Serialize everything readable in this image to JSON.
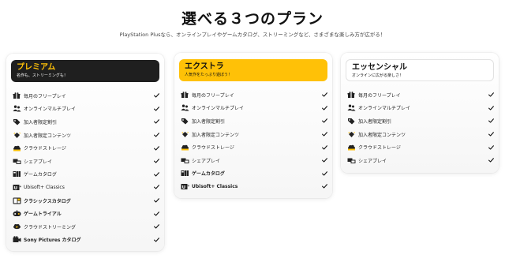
{
  "header": {
    "title": "選べる３つのプラン",
    "subtitle": "PlayStation Plusなら、オンラインプレイやゲームカタログ、ストリーミングなど、さまざまな楽しみ方が広がる！"
  },
  "colors": {
    "accent_yellow": "#ffc107",
    "dark": "#1f1f1f",
    "check": "#111111"
  },
  "plans": [
    {
      "name": "プレミアム",
      "description": "名作も、ストリーミングも！",
      "features": [
        {
          "label": "毎月のフリープレイ",
          "icon": "gift-icon",
          "bold": false
        },
        {
          "label": "オンラインマルチプレイ",
          "icon": "multiplayer-icon",
          "bold": false
        },
        {
          "label": "加入者限定割引",
          "icon": "discount-tag-icon",
          "bold": false
        },
        {
          "label": "加入者限定コンテンツ",
          "icon": "exclusive-content-icon",
          "bold": false
        },
        {
          "label": "クラウドストレージ",
          "icon": "cloud-storage-icon",
          "bold": false
        },
        {
          "label": "シェアプレイ",
          "icon": "share-play-icon",
          "bold": false
        },
        {
          "label": "ゲームカタログ",
          "icon": "game-catalog-icon",
          "bold": false
        },
        {
          "label": "Ubisoft+ Classics",
          "icon": "ubisoft-icon",
          "bold": false
        },
        {
          "label": "クラシックスカタログ",
          "icon": "classics-catalog-icon",
          "bold": true
        },
        {
          "label": "ゲームトライアル",
          "icon": "game-trial-icon",
          "bold": true
        },
        {
          "label": "クラウドストリーミング",
          "icon": "cloud-streaming-icon",
          "bold": false
        },
        {
          "label": "Sony Pictures カタログ",
          "icon": "sony-pictures-icon",
          "bold": true
        }
      ]
    },
    {
      "name": "エクストラ",
      "description": "人気作をたっぷり遊ぼう！",
      "features": [
        {
          "label": "毎月のフリープレイ",
          "icon": "gift-icon",
          "bold": false
        },
        {
          "label": "オンラインマルチプレイ",
          "icon": "multiplayer-icon",
          "bold": false
        },
        {
          "label": "加入者限定割引",
          "icon": "discount-tag-icon",
          "bold": false
        },
        {
          "label": "加入者限定コンテンツ",
          "icon": "exclusive-content-icon",
          "bold": false
        },
        {
          "label": "クラウドストレージ",
          "icon": "cloud-storage-icon",
          "bold": false
        },
        {
          "label": "シェアプレイ",
          "icon": "share-play-icon",
          "bold": false
        },
        {
          "label": "ゲームカタログ",
          "icon": "game-catalog-icon",
          "bold": true
        },
        {
          "label": "Ubisoft+ Classics",
          "icon": "ubisoft-icon",
          "bold": true
        }
      ]
    },
    {
      "name": "エッセンシャル",
      "description": "オンラインに広がる楽しさ！",
      "features": [
        {
          "label": "毎月のフリープレイ",
          "icon": "gift-icon",
          "bold": false
        },
        {
          "label": "オンラインマルチプレイ",
          "icon": "multiplayer-icon",
          "bold": false
        },
        {
          "label": "加入者限定割引",
          "icon": "discount-tag-icon",
          "bold": false
        },
        {
          "label": "加入者限定コンテンツ",
          "icon": "exclusive-content-icon",
          "bold": false
        },
        {
          "label": "クラウドストレージ",
          "icon": "cloud-storage-icon",
          "bold": false
        },
        {
          "label": "シェアプレイ",
          "icon": "share-play-icon",
          "bold": false
        }
      ]
    }
  ]
}
